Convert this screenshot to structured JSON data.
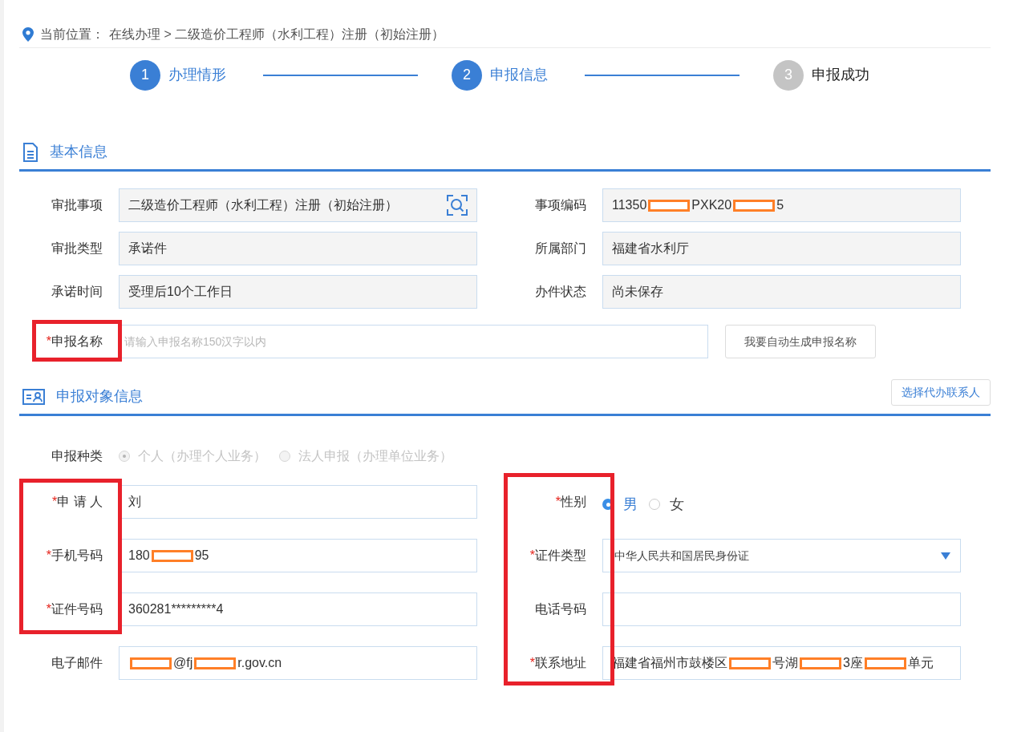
{
  "breadcrumb": {
    "label": "当前位置：",
    "path": "在线办理 > 二级造价工程师（水利工程）注册（初始注册）"
  },
  "steps": [
    {
      "number": "1",
      "label": "办理情形",
      "active": true
    },
    {
      "number": "2",
      "label": "申报信息",
      "active": true
    },
    {
      "number": "3",
      "label": "申报成功",
      "active": false
    }
  ],
  "basic_info": {
    "title": "基本信息",
    "fields": [
      {
        "label": "审批事项",
        "segments": [
          {
            "kind": "text",
            "text": "二级造价工程师（水利工程）注册（初始注册）"
          }
        ],
        "search_button": true
      },
      {
        "label": "事项编码",
        "segments": [
          {
            "kind": "text",
            "text": "11350"
          },
          {
            "kind": "redacted"
          },
          {
            "kind": "text",
            "text": "PXK20"
          },
          {
            "kind": "redacted"
          },
          {
            "kind": "text",
            "text": "5"
          }
        ]
      },
      {
        "label": "审批类型",
        "segments": [
          {
            "kind": "text",
            "text": "承诺件"
          }
        ]
      },
      {
        "label": "所属部门",
        "segments": [
          {
            "kind": "text",
            "text": "福建省水利厅"
          }
        ]
      },
      {
        "label": "承诺时间",
        "segments": [
          {
            "kind": "text",
            "text": "受理后10个工作日"
          }
        ]
      },
      {
        "label": "办件状态",
        "segments": [
          {
            "kind": "text",
            "text": "尚未保存"
          }
        ]
      }
    ],
    "name_field": {
      "marker": "*",
      "label": "申报名称",
      "highlighted": true,
      "placeholder": "请输入申报名称150汉字以内",
      "button": "我要自动生成申报名称"
    }
  },
  "applicant_info": {
    "title": "申报对象信息",
    "button": "选择代办联系人",
    "type_row": {
      "label": "申报种类",
      "disabled": true,
      "options": [
        {
          "label": "个人（办理个人业务）",
          "selected": true
        },
        {
          "label": "法人申报（办理单位业务）",
          "selected": false
        }
      ]
    },
    "left_fields": [
      {
        "kind": "text",
        "marker": "*",
        "label": "申 请 人",
        "highlighted": true,
        "segments": [
          {
            "kind": "text",
            "text": "刘"
          }
        ]
      },
      {
        "kind": "text",
        "marker": "*",
        "label": "手机号码",
        "highlighted": true,
        "segments": [
          {
            "kind": "text",
            "text": "180"
          },
          {
            "kind": "redacted"
          },
          {
            "kind": "text",
            "text": "95"
          }
        ]
      },
      {
        "kind": "text",
        "marker": "*",
        "label": "证件号码",
        "highlighted": true,
        "segments": [
          {
            "kind": "text",
            "text": "360281*********4"
          }
        ]
      },
      {
        "kind": "text",
        "label": "电子邮件",
        "segments": [
          {
            "kind": "redacted"
          },
          {
            "kind": "text",
            "text": "@fj"
          },
          {
            "kind": "redacted"
          },
          {
            "kind": "text",
            "text": "r.gov.cn"
          }
        ]
      }
    ],
    "right_fields": [
      {
        "kind": "radio",
        "marker": "*",
        "label": "性别",
        "highlighted": true,
        "options": [
          {
            "label": "男",
            "selected": true
          },
          {
            "label": "女",
            "selected": false
          }
        ]
      },
      {
        "kind": "select",
        "marker": "*",
        "label": "证件类型",
        "highlighted": true,
        "value": "中华人民共和国居民身份证"
      },
      {
        "kind": "text",
        "label": "电话号码",
        "highlighted": true
      },
      {
        "kind": "text",
        "marker": "*",
        "label": "联系地址",
        "highlighted": true,
        "segments": [
          {
            "kind": "text",
            "text": "福建省福州市鼓楼区"
          },
          {
            "kind": "redacted"
          },
          {
            "kind": "text",
            "text": "号湖"
          },
          {
            "kind": "redacted"
          },
          {
            "kind": "text",
            "text": "3座"
          },
          {
            "kind": "redacted"
          },
          {
            "kind": "text",
            "text": "单元"
          }
        ]
      }
    ]
  }
}
